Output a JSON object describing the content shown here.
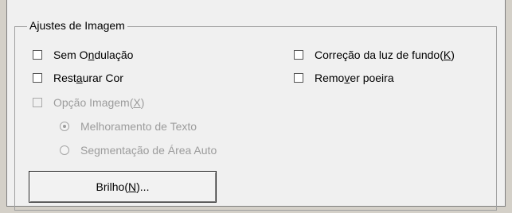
{
  "group": {
    "title": "Ajustes de Imagem"
  },
  "options": {
    "sem_ondulacao": {
      "pre": "Sem O",
      "mn": "n",
      "post": "dulação",
      "checked": false
    },
    "restaurar_cor": {
      "pre": "Rest",
      "mn": "a",
      "post": "urar Cor",
      "checked": false
    },
    "opcao_imagem": {
      "pre": "Opção Imagem(",
      "mn": "X",
      "post": ")",
      "checked": false,
      "enabled": false
    },
    "correcao_luz": {
      "pre": "Correção da luz de fundo(",
      "mn": "K",
      "post": ")",
      "checked": false
    },
    "remover_poeira": {
      "pre": "Remo",
      "mn": "v",
      "post": "er poeira",
      "checked": false
    }
  },
  "radios": {
    "melhoramento": {
      "label": "Melhoramento de Texto",
      "selected": true,
      "enabled": false
    },
    "segmentacao": {
      "label": "Segmentação de Área Auto",
      "selected": false,
      "enabled": false
    }
  },
  "button": {
    "pre": "Brilho(",
    "mn": "N",
    "post": ")..."
  }
}
